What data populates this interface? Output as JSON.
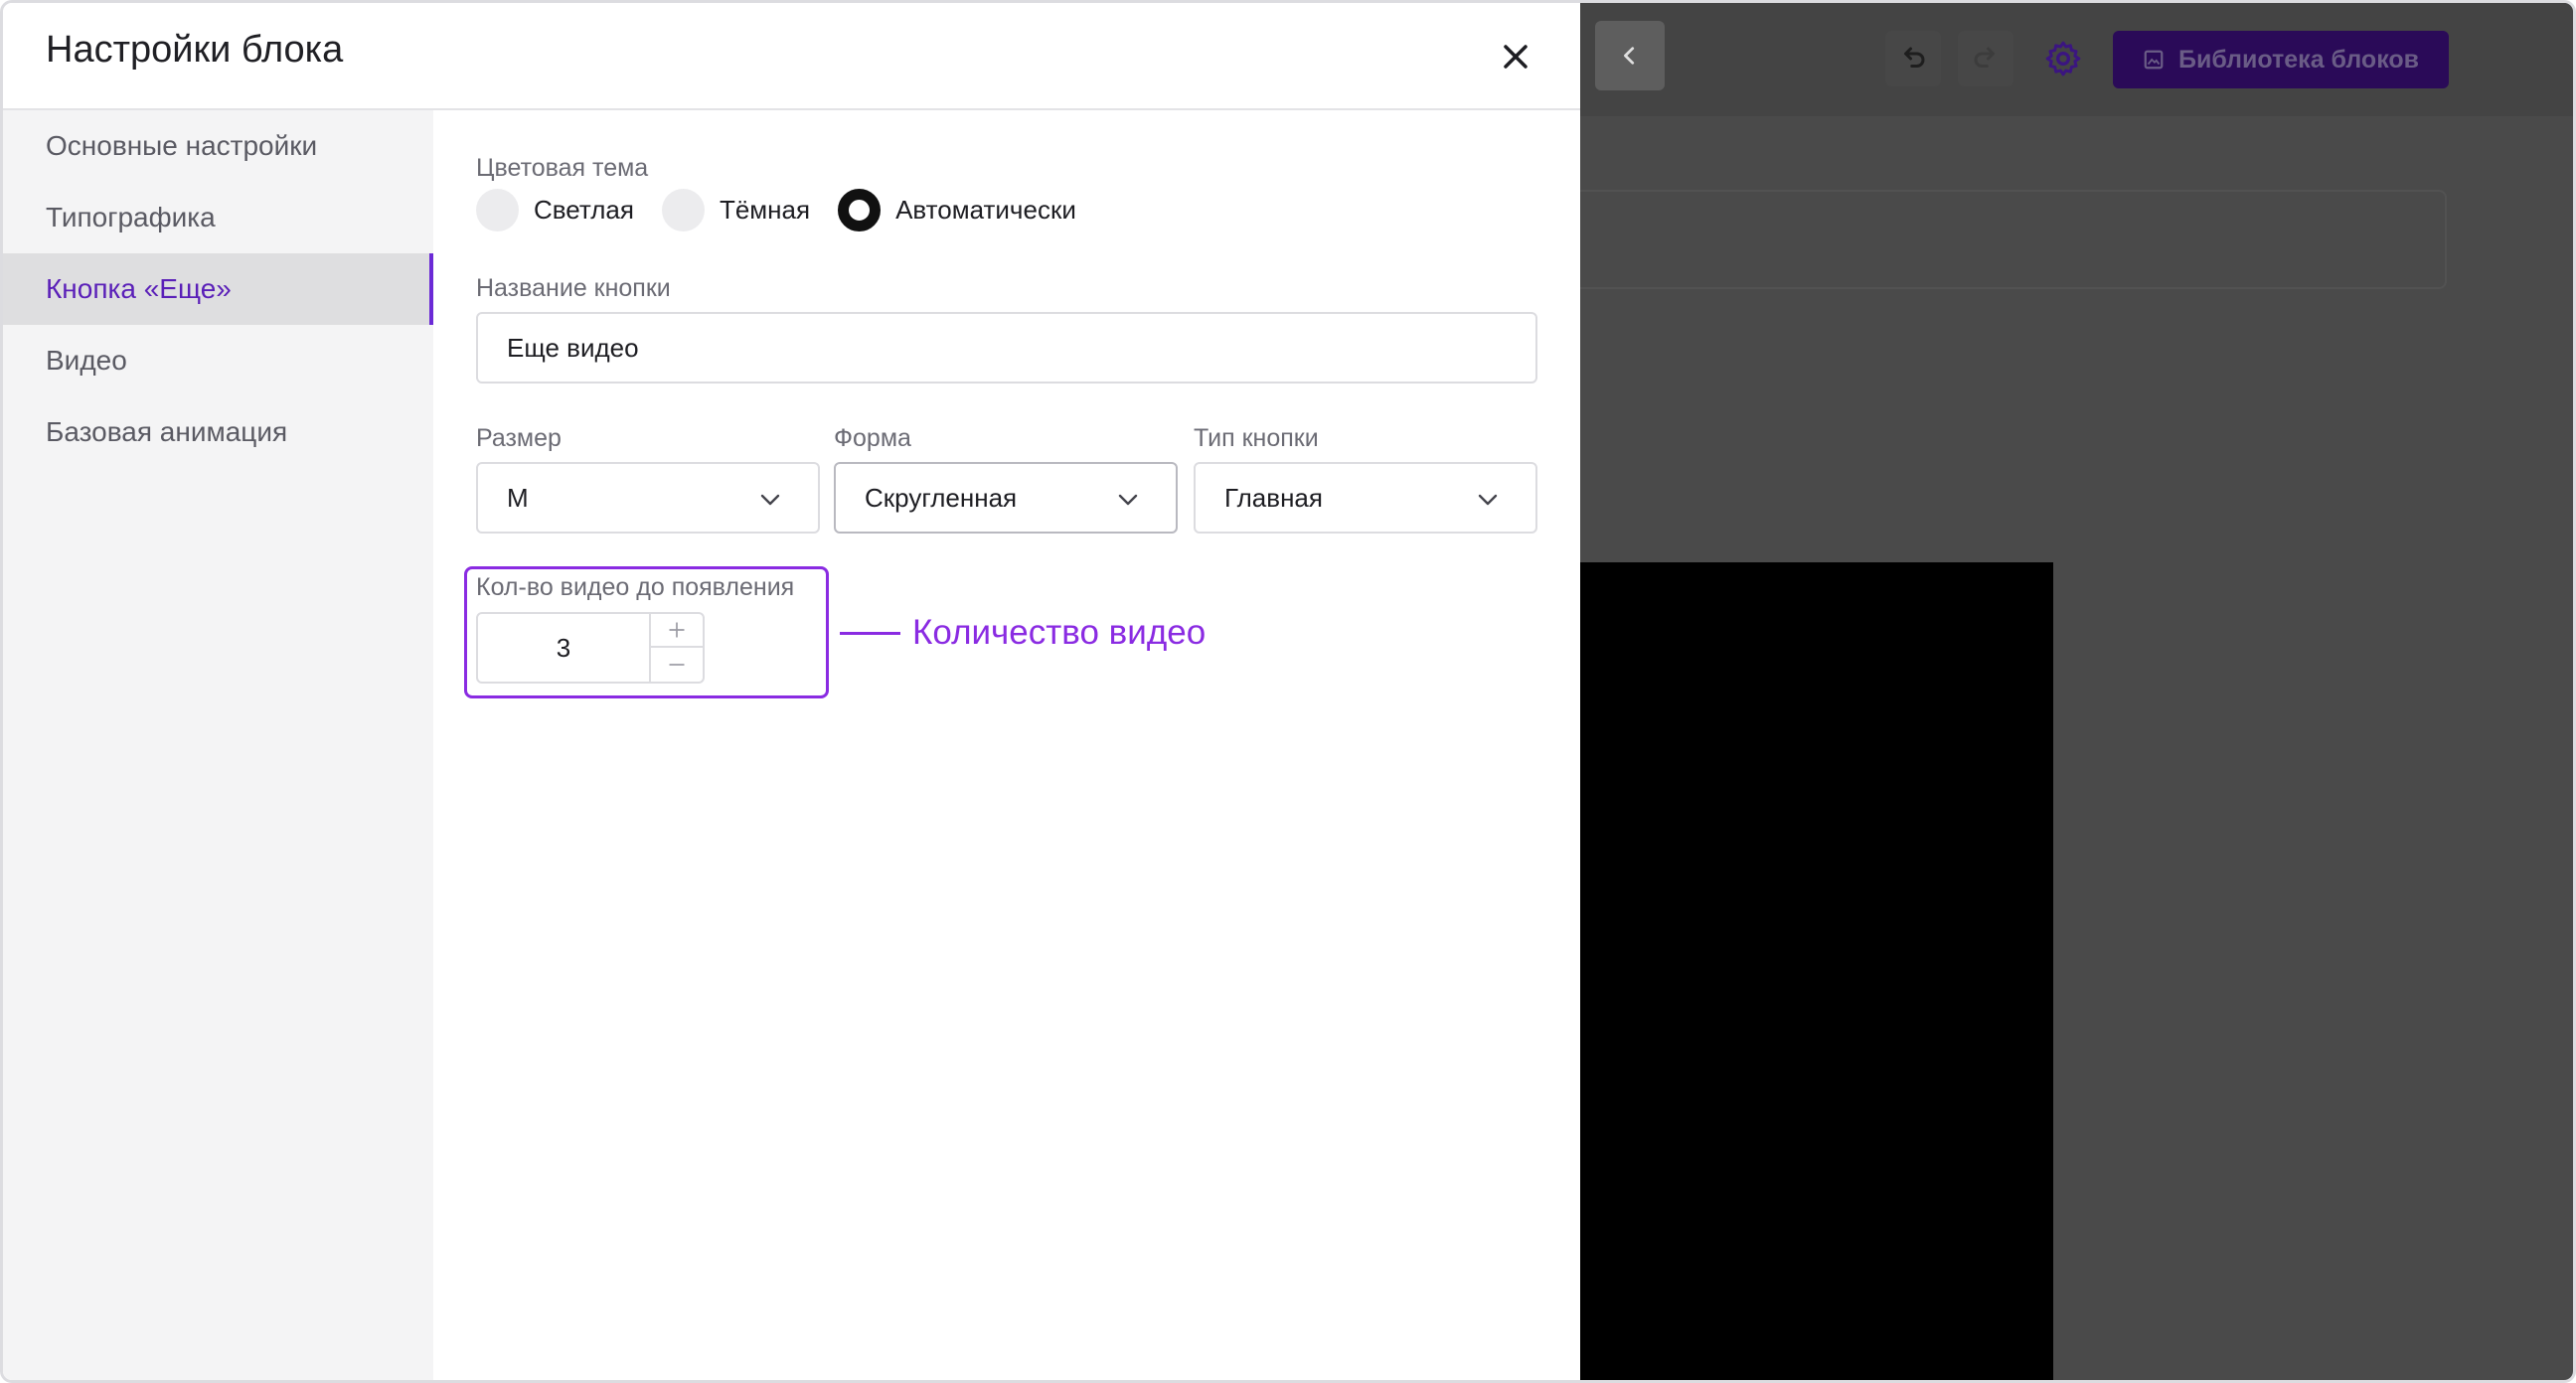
{
  "modal": {
    "title": "Настройки блока"
  },
  "sidebar": {
    "items": [
      {
        "label": "Основные настройки"
      },
      {
        "label": "Типографика"
      },
      {
        "label": "Кнопка «Еще»"
      },
      {
        "label": "Видео"
      },
      {
        "label": "Базовая анимация"
      }
    ],
    "active_index": 2
  },
  "form": {
    "color_theme": {
      "label": "Цветовая тема",
      "options": [
        "Светлая",
        "Тёмная",
        "Автоматически"
      ],
      "selected": "Автоматически"
    },
    "button_name": {
      "label": "Название кнопки",
      "value": "Еще видео"
    },
    "size": {
      "label": "Размер",
      "value": "M"
    },
    "shape": {
      "label": "Форма",
      "value": "Скругленная"
    },
    "button_type": {
      "label": "Тип кнопки",
      "value": "Главная"
    },
    "video_count": {
      "label": "Кол-во видео до появления",
      "value": "3",
      "plus": "+",
      "minus": "–"
    }
  },
  "annotation": {
    "text": "Количество видео",
    "color": "#8a2be2"
  },
  "editor": {
    "library_button": "Библиотека блоков"
  },
  "colors": {
    "accent": "#6b2ad6",
    "overlay": "#4a4a4a",
    "library_button_bg": "#2a0a58"
  }
}
